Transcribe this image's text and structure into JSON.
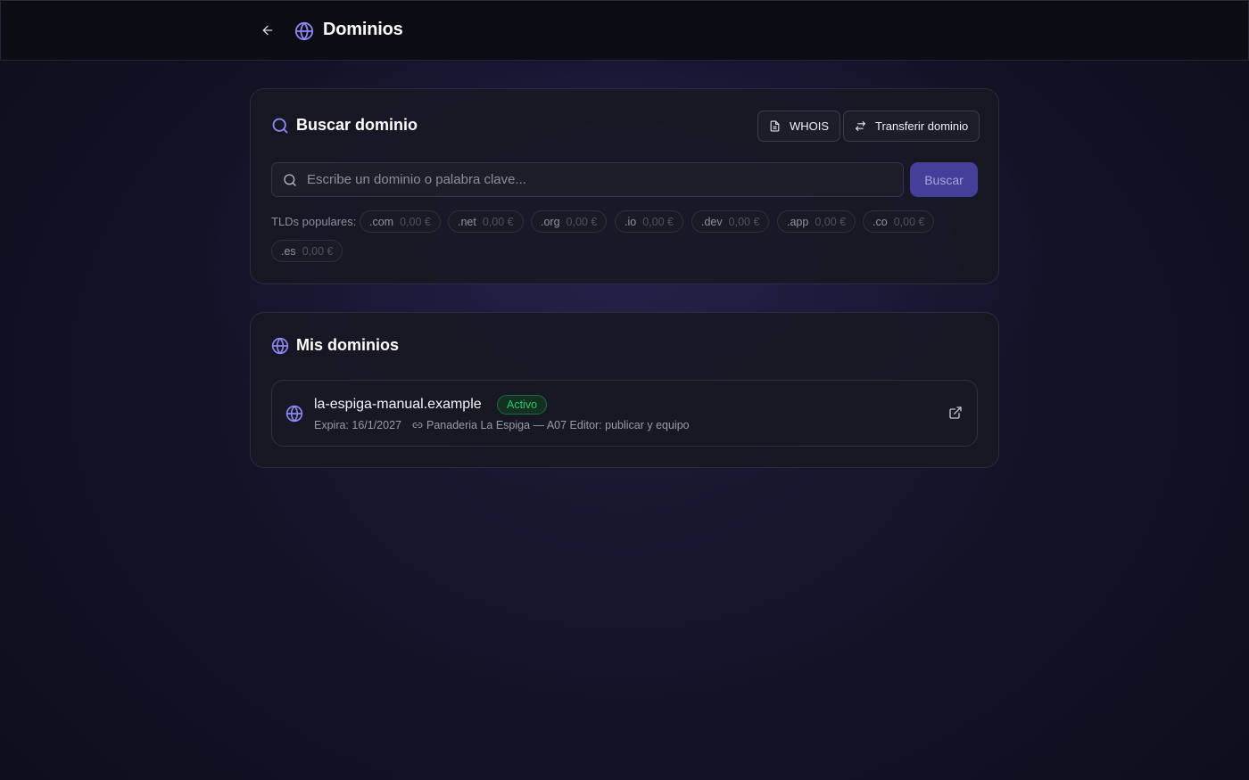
{
  "header": {
    "title": "Dominios",
    "back_icon": "arrow-left-icon",
    "title_icon": "globe-icon"
  },
  "search_card": {
    "title": "Buscar dominio",
    "title_icon": "search-icon",
    "whois_label": "WHOIS",
    "transfer_label": "Transferir dominio",
    "input_placeholder": "Escribe un dominio o palabra clave...",
    "input_value": "",
    "search_button_label": "Buscar",
    "tld_label": "TLDs populares:",
    "tlds": [
      {
        "ext": ".com",
        "price": "0,00 €"
      },
      {
        "ext": ".net",
        "price": "0,00 €"
      },
      {
        "ext": ".org",
        "price": "0,00 €"
      },
      {
        "ext": ".io",
        "price": "0,00 €"
      },
      {
        "ext": ".dev",
        "price": "0,00 €"
      },
      {
        "ext": ".app",
        "price": "0,00 €"
      },
      {
        "ext": ".co",
        "price": "0,00 €"
      },
      {
        "ext": ".es",
        "price": "0,00 €"
      }
    ]
  },
  "my_domains": {
    "title": "Mis dominios",
    "items": [
      {
        "name": "la-espiga-manual.example",
        "status": "Activo",
        "expires": "Expira: 16/1/2027",
        "linked_site": "Panaderia La Espiga — A07 Editor: publicar y equipo"
      }
    ]
  },
  "colors": {
    "accent": "#7f7cf0",
    "primary_button": "#463f9a",
    "status_active": "#33c46a",
    "background": "#14142a"
  }
}
